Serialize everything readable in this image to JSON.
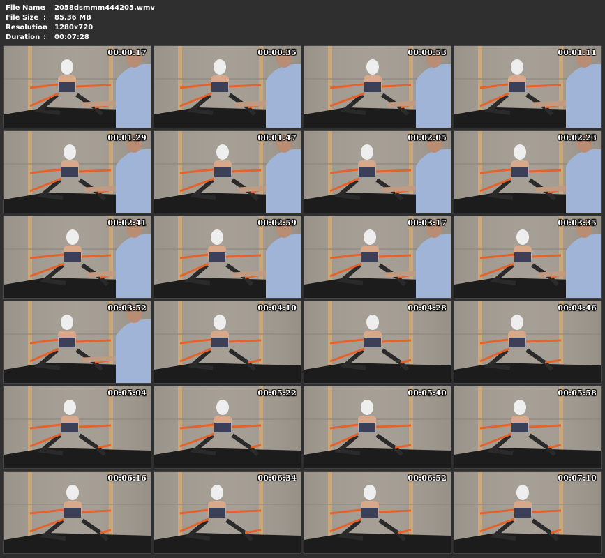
{
  "file_info": {
    "file_name_label": "File Name",
    "file_name": "2058dsmmm444205.wmv",
    "file_size_label": "File Size",
    "file_size": "85.36 MB",
    "resolution_label": "Resolution",
    "resolution": "1280x720",
    "duration_label": "Duration",
    "duration": "00:07:28",
    "separator": ":"
  },
  "thumbnails": [
    {
      "timestamp": "00:00:17",
      "man": true
    },
    {
      "timestamp": "00:00:35",
      "man": true
    },
    {
      "timestamp": "00:00:53",
      "man": true
    },
    {
      "timestamp": "00:01:11",
      "man": true
    },
    {
      "timestamp": "00:01:29",
      "man": true
    },
    {
      "timestamp": "00:01:47",
      "man": true
    },
    {
      "timestamp": "00:02:05",
      "man": true
    },
    {
      "timestamp": "00:02:23",
      "man": true
    },
    {
      "timestamp": "00:02:41",
      "man": true
    },
    {
      "timestamp": "00:02:59",
      "man": true
    },
    {
      "timestamp": "00:03:17",
      "man": true
    },
    {
      "timestamp": "00:03:35",
      "man": true
    },
    {
      "timestamp": "00:03:52",
      "man": true
    },
    {
      "timestamp": "00:04:10",
      "man": false
    },
    {
      "timestamp": "00:04:28",
      "man": false
    },
    {
      "timestamp": "00:04:46",
      "man": false
    },
    {
      "timestamp": "00:05:04",
      "man": false
    },
    {
      "timestamp": "00:05:22",
      "man": false
    },
    {
      "timestamp": "00:05:40",
      "man": false
    },
    {
      "timestamp": "00:05:58",
      "man": false
    },
    {
      "timestamp": "00:06:16",
      "man": false
    },
    {
      "timestamp": "00:06:34",
      "man": false
    },
    {
      "timestamp": "00:06:52",
      "man": false
    },
    {
      "timestamp": "00:07:10",
      "man": false
    }
  ],
  "colors": {
    "background": "#2f2f2f",
    "wall": "#a39c92",
    "floor": "#1c1c1c",
    "rope": "#e5622a",
    "shirt": "#9fb4d6",
    "text": "#ffffff"
  }
}
